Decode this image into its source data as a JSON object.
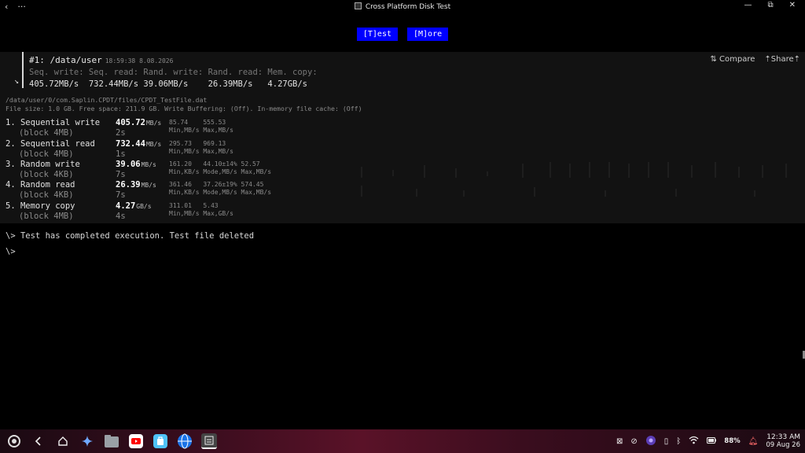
{
  "window": {
    "title": "Cross Platform Disk Test",
    "back_glyph": "‹",
    "menu_glyph": "···",
    "minimize_glyph": "—",
    "maximize_glyph": "⧉",
    "close_glyph": "✕"
  },
  "toolbar": {
    "test_label": "[T]est",
    "more_label": "[M]ore"
  },
  "summary": {
    "title": "#1: /data/user",
    "timestamp": "18:59:38 8.08.2026",
    "labels": "Seq. write: Seq. read: Rand. write: Rand. read: Mem. copy:",
    "values": "405.72MB/s  732.44MB/s 39.06MB/s    26.39MB/s   4.27GB/s",
    "compare_label": "⇅ Compare",
    "share_label": "⇡Share⇡",
    "arrow_glyph": "↘"
  },
  "file_path": "/data/user/0/com.Saplin.CPDT/files/CPDT_TestFile.dat",
  "file_info": "File size: 1.0 GB. Free space: 211.9 GB. Write Buffering: (Off). In-memory file cache: (Off)",
  "results": [
    {
      "name": "1. Sequential write",
      "block": "(block 4MB)",
      "value": "405.72",
      "unit": "MB/s",
      "time": "2s",
      "stats": "85.74    555.53",
      "stat_labels": "Min,MB/s Max,MB/s"
    },
    {
      "name": "2. Sequential read",
      "block": "(block 4MB)",
      "value": "732.44",
      "unit": "MB/s",
      "time": "1s",
      "stats": "295.73   969.13",
      "stat_labels": "Min,MB/s Max,MB/s"
    },
    {
      "name": "3. Random write",
      "block": "(block 4KB)",
      "value": "39.06",
      "unit": "MB/s",
      "time": "7s",
      "stats": "161.20   44.10±14% 52.57",
      "stat_labels": "Min,KB/s Mode,MB/s Max,MB/s"
    },
    {
      "name": "4. Random read",
      "block": "(block 4KB)",
      "value": "26.39",
      "unit": "MB/s",
      "time": "7s",
      "stats": "361.46   37.26±19% 574.45",
      "stat_labels": "Min,KB/s Mode,MB/s Max,MB/s"
    },
    {
      "name": "5. Memory copy",
      "block": "(block 4MB)",
      "value": "4.27",
      "unit": "GB/s",
      "time": "4s",
      "stats": "311.01   5.43",
      "stat_labels": "Min,MB/s Max,GB/s"
    }
  ],
  "console": {
    "line1": "\\> Test has completed execution. Test file deleted",
    "line2": "\\>"
  },
  "taskbar": {
    "battery": "88%",
    "time": "12:33 AM",
    "date": "09 Aug 26"
  },
  "colors": {
    "accent_button": "#0000ff",
    "panel_bg": "#121212"
  }
}
